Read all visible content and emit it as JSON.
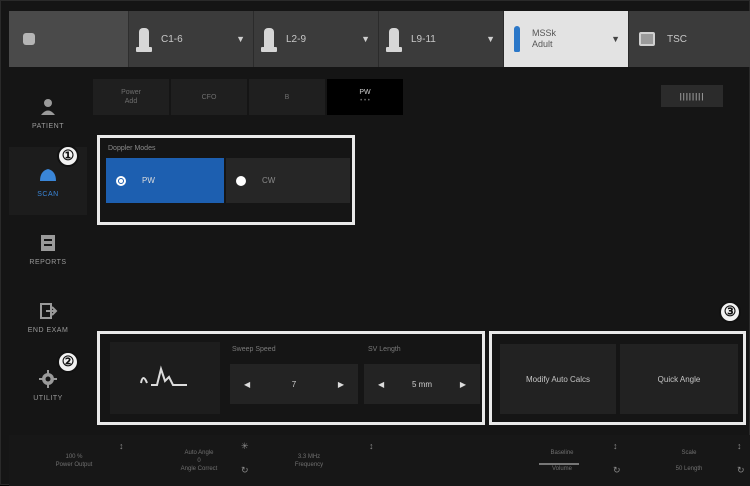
{
  "probes": [
    {
      "name": "C1-6"
    },
    {
      "name": "L2-9"
    },
    {
      "name": "L9-11"
    },
    {
      "name": "MSSk\nAdult"
    },
    {
      "name": "TSC"
    }
  ],
  "sidebar": {
    "items": [
      {
        "label": "PATIENT"
      },
      {
        "label": "SCAN"
      },
      {
        "label": "REPORTS"
      },
      {
        "label": "END EXAM"
      },
      {
        "label": "UTILITY"
      }
    ]
  },
  "tabs": [
    {
      "label": "Power\nAdd"
    },
    {
      "label": "CFO"
    },
    {
      "label": "B"
    },
    {
      "label": "PW",
      "sub": "• • •"
    }
  ],
  "keyboard_label": "||||||||",
  "doppler": {
    "title": "Doppler Modes",
    "pw_label": "PW",
    "cw_label": "CW"
  },
  "controls": {
    "sweep_speed_label": "Sweep Speed",
    "sweep_speed_value": "7",
    "sv_length_label": "SV Length",
    "sv_length_value": "5 mm",
    "modify_auto_calcs": "Modify Auto Calcs",
    "quick_angle": "Quick Angle"
  },
  "badges": [
    "①",
    "②",
    "③"
  ],
  "bottom_bar": {
    "items": [
      {
        "label": "100 %\nPower Output"
      },
      {
        "label": "Auto Angle\n0\nAngle Correct"
      },
      {
        "label": "3.3 MHz\nFrequency"
      },
      {
        "label": "Baseline\n\nVolume"
      },
      {
        "label": "Scale\n\n50 Length"
      }
    ]
  },
  "colors": {
    "accent": "#1d5fb0",
    "highlight": "#e9e9e9"
  }
}
